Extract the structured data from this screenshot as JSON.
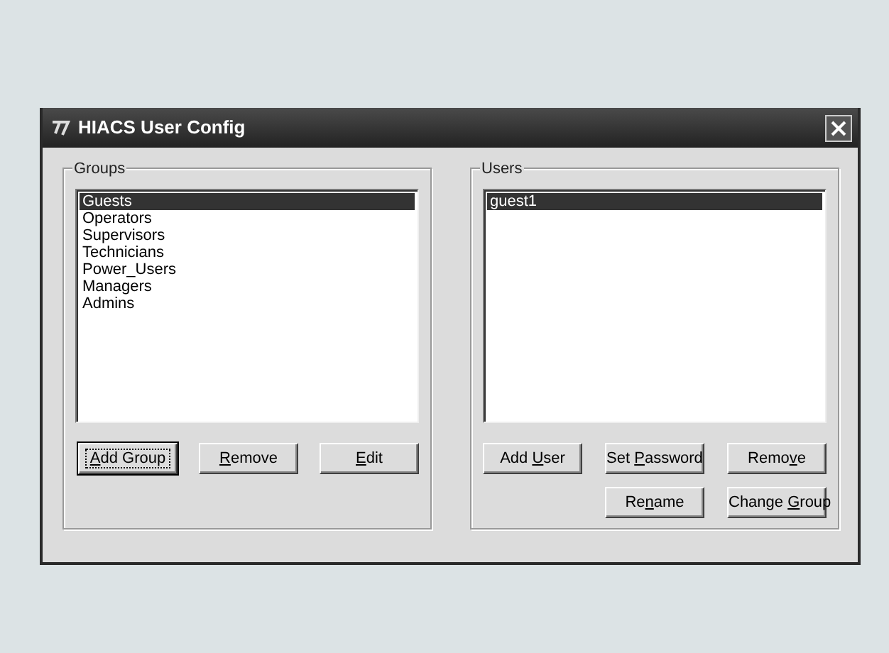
{
  "window": {
    "title": "HIACS User Config"
  },
  "groups": {
    "label": "Groups",
    "items": [
      {
        "text": "Guests",
        "selected": true
      },
      {
        "text": "Operators",
        "selected": false
      },
      {
        "text": "Supervisors",
        "selected": false
      },
      {
        "text": "Technicians",
        "selected": false
      },
      {
        "text": "Power_Users",
        "selected": false
      },
      {
        "text": "Managers",
        "selected": false
      },
      {
        "text": "Admins",
        "selected": false
      }
    ],
    "buttons": [
      {
        "key": "A",
        "post": "dd Group",
        "focused": true
      },
      {
        "key": "R",
        "post": "emove",
        "focused": false
      },
      {
        "key": "E",
        "post": "dit",
        "focused": false
      }
    ]
  },
  "users": {
    "label": "Users",
    "items": [
      {
        "text": "guest1",
        "selected": true
      }
    ],
    "buttons": [
      {
        "pre": "Add ",
        "key": "U",
        "post": "ser",
        "focused": false
      },
      {
        "pre": "Set ",
        "key": "P",
        "post": "assword",
        "focused": false
      },
      {
        "pre": "Remo",
        "key": "v",
        "post": "e",
        "focused": false
      },
      {
        "pre": "Re",
        "key": "n",
        "post": "ame",
        "focused": false
      },
      {
        "pre": "Change ",
        "key": "G",
        "post": "roup",
        "focused": false
      }
    ]
  }
}
